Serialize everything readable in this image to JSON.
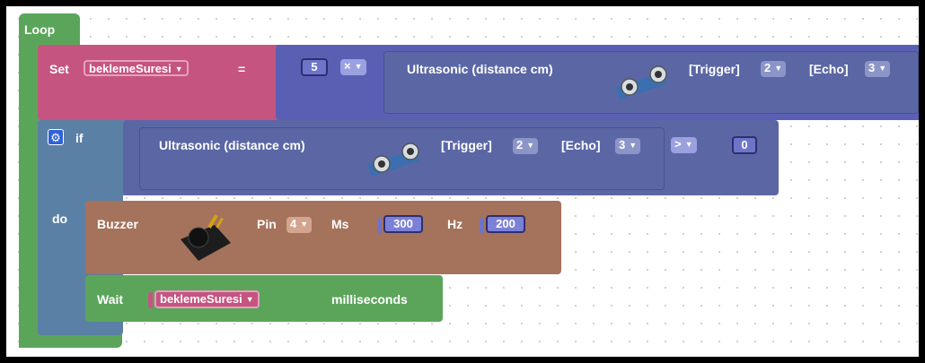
{
  "colors": {
    "loop": "#5ba55b",
    "set": "#c55580",
    "math": "#5b5fb4",
    "sensor": "#5b67a5",
    "control": "#5b80a5",
    "buzzer": "#a5725b",
    "value": "#8888e8"
  },
  "loop": {
    "label": "Loop"
  },
  "set": {
    "label": "Set",
    "variable": "beklemeSuresi",
    "equals": "=",
    "number": "5",
    "operator": "×",
    "sensor_label": "Ultrasonic (distance cm)",
    "sensor_icon": "ultrasonic-sensor-icon",
    "trigger_label": "[Trigger]",
    "trigger_value": "2",
    "echo_label": "[Echo]",
    "echo_value": "3"
  },
  "if_block": {
    "gear_icon": "gear-icon",
    "if_label": "if",
    "do_label": "do",
    "sensor_label": "Ultrasonic (distance cm)",
    "sensor_icon": "ultrasonic-sensor-icon",
    "trigger_label": "[Trigger]",
    "trigger_value": "2",
    "echo_label": "[Echo]",
    "echo_value": "3",
    "comparator": ">",
    "compare_value": "0"
  },
  "buzzer": {
    "label": "Buzzer",
    "icon": "buzzer-module-icon",
    "pin_label": "Pin",
    "pin_value": "4",
    "ms_label": "Ms",
    "ms_value": "300",
    "hz_label": "Hz",
    "hz_value": "200"
  },
  "wait": {
    "label": "Wait",
    "variable": "beklemeSuresi",
    "unit": "milliseconds"
  }
}
